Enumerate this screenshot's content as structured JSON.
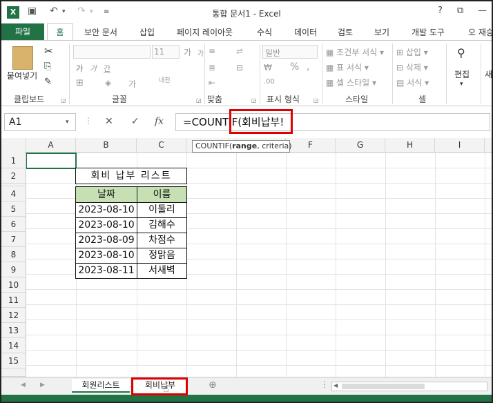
{
  "window": {
    "title": "통합 문서1 - Excel",
    "help": "?"
  },
  "tabs": [
    "파일",
    "홈",
    "보안 문서",
    "삽입",
    "페이지 레이아웃",
    "수식",
    "데이터",
    "검토",
    "보기",
    "개발 도구",
    "오 재승"
  ],
  "ribbon": {
    "clipboard": {
      "label": "클립보드",
      "paste": "붙여넣기"
    },
    "font": {
      "label": "글꼴",
      "size": "11",
      "bold": "가",
      "italic": "가",
      "underline": "간",
      "grow": "가",
      "shrink": "가",
      "phonetic": "내천",
      "fill_letter": "가"
    },
    "alignment": {
      "label": "맞춤"
    },
    "number": {
      "label": "표시 형식",
      "format": "일반",
      "percent": "%"
    },
    "styles": {
      "label": "스타일",
      "conditional": "조건부 서식",
      "table": "표 서식",
      "cell_style": "셀 스타일"
    },
    "cells": {
      "label": "셀",
      "insert": "삽입",
      "delete": "삭제",
      "format": "서식"
    },
    "editing": {
      "label": "편집"
    },
    "more": {
      "label": "새로"
    }
  },
  "formula_bar": {
    "name_box": "A1",
    "formula": "=COUNTIF(회비납부!",
    "cancel": "✕",
    "enter": "✓",
    "fx": "fx"
  },
  "tooltip": {
    "func": "COUNTIF(",
    "arg1": "range",
    "rest": ", criteria)"
  },
  "columns": [
    "A",
    "B",
    "C",
    "D",
    "E",
    "F",
    "G",
    "H",
    "I"
  ],
  "rows": [
    "1",
    "2",
    "3",
    "4",
    "5",
    "6",
    "7",
    "8",
    "9",
    "10",
    "11",
    "12",
    "13",
    "14",
    "15"
  ],
  "table": {
    "title": "회비 납부 리스트",
    "headers": [
      "날짜",
      "이름"
    ],
    "rows": [
      [
        "2023-08-10",
        "이둘리"
      ],
      [
        "2023-08-10",
        "김해수"
      ],
      [
        "2023-08-09",
        "차점수"
      ],
      [
        "2023-08-10",
        "정맑음"
      ],
      [
        "2023-08-11",
        "서새벽"
      ]
    ]
  },
  "sheets": [
    "회원리스트",
    "회비납부"
  ],
  "colors": {
    "excel_green": "#217346",
    "header_fill": "#c6e0b4",
    "highlight": "#e00000"
  }
}
